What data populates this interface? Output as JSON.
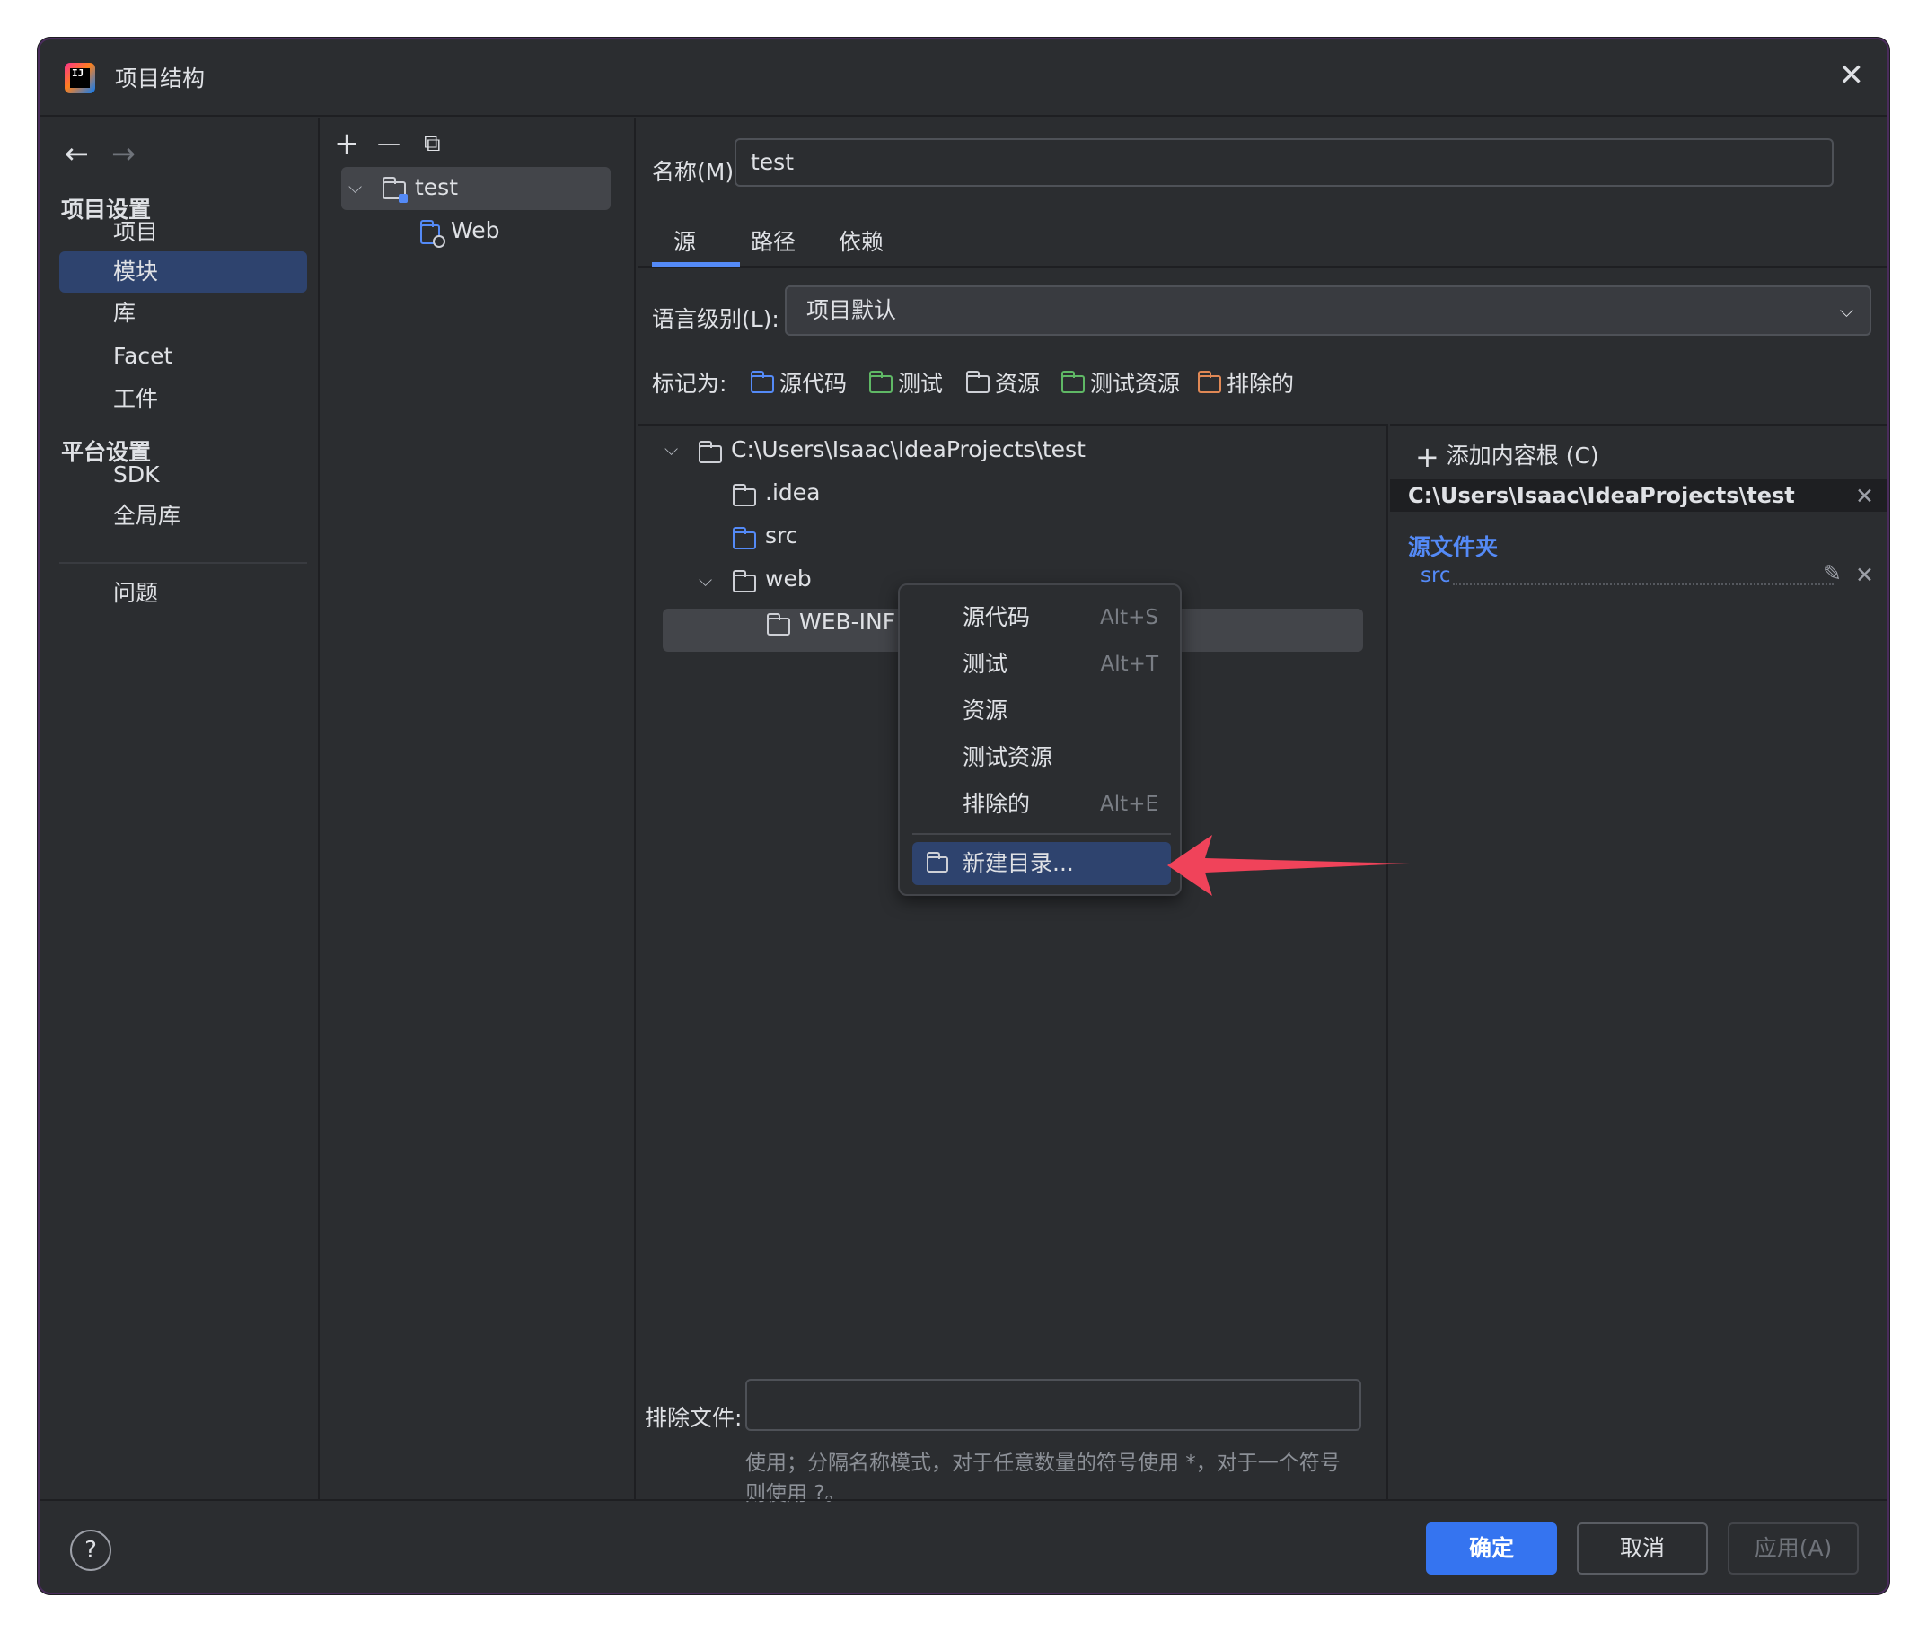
{
  "window": {
    "title": "项目结构"
  },
  "nav": {
    "section_project": "项目设置",
    "item_project": "项目",
    "item_modules": "模块",
    "item_libraries": "库",
    "item_facets": "Facet",
    "item_artifacts": "工件",
    "section_platform": "平台设置",
    "item_sdk": "SDK",
    "item_global_libs": "全局库",
    "item_problems": "问题"
  },
  "modules": {
    "toolbar": {
      "add": "+",
      "remove": "—",
      "copy": "⧉"
    },
    "tree": [
      {
        "label": "test"
      },
      {
        "label": "Web"
      }
    ]
  },
  "content": {
    "name_label": "名称(M):",
    "name_value": "test",
    "tabs": [
      "源",
      "路径",
      "依赖"
    ],
    "lang_label": "语言级别(L):",
    "lang_value": "项目默认",
    "mark_label": "标记为:",
    "marks": [
      "源代码",
      "测试",
      "资源",
      "测试资源",
      "排除的"
    ],
    "tree": {
      "root": "C:\\Users\\Isaac\\IdeaProjects\\test",
      "idea": ".idea",
      "src": "src",
      "web": "web",
      "webinf": "WEB-INF"
    },
    "exclude_label": "排除文件:",
    "exclude_value": "",
    "hint_line1": "使用；分隔名称模式，对于任意数量的符号使用 *，对于一个符号",
    "hint_line2": "则使用 ?。"
  },
  "right_panel": {
    "add_root": "添加内容根 (C)",
    "root_path": "C:\\Users\\Isaac\\IdeaProjects\\test",
    "source_folders_title": "源文件夹",
    "source_item": "src"
  },
  "context_menu": {
    "items": [
      {
        "label": "源代码",
        "shortcut": "Alt+S"
      },
      {
        "label": "测试",
        "shortcut": "Alt+T"
      },
      {
        "label": "资源",
        "shortcut": ""
      },
      {
        "label": "测试资源",
        "shortcut": ""
      },
      {
        "label": "排除的",
        "shortcut": "Alt+E"
      }
    ],
    "new_dir": "新建目录..."
  },
  "footer": {
    "help": "?",
    "ok": "确定",
    "cancel": "取消",
    "apply": "应用(A)"
  },
  "colors": {
    "accent": "#3574f0",
    "selection": "#2e436e",
    "annotation_arrow": "#f0435a"
  }
}
